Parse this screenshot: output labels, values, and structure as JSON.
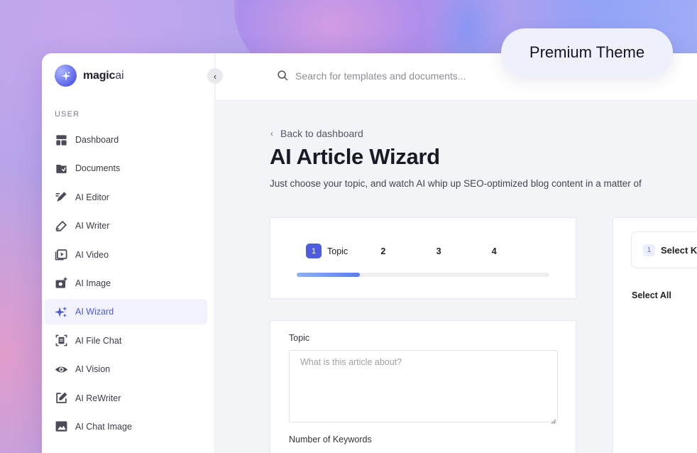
{
  "badge": {
    "label": "Premium Theme"
  },
  "brand": {
    "name_bold": "magic",
    "name_light": "ai"
  },
  "sidebar": {
    "section_label": "USER",
    "items": [
      {
        "label": "Dashboard",
        "icon": "dashboard-icon"
      },
      {
        "label": "Documents",
        "icon": "folder-icon"
      },
      {
        "label": "AI Editor",
        "icon": "editor-icon"
      },
      {
        "label": "AI Writer",
        "icon": "writer-icon"
      },
      {
        "label": "AI Video",
        "icon": "video-icon"
      },
      {
        "label": "AI Image",
        "icon": "camera-icon"
      },
      {
        "label": "AI Wizard",
        "icon": "sparkles-icon",
        "active": true
      },
      {
        "label": "AI File Chat",
        "icon": "file-chat-icon"
      },
      {
        "label": "AI Vision",
        "icon": "eye-icon"
      },
      {
        "label": "AI ReWriter",
        "icon": "pencil-square-icon"
      },
      {
        "label": "AI Chat Image",
        "icon": "image-icon"
      }
    ]
  },
  "search": {
    "placeholder": "Search for templates and documents..."
  },
  "main": {
    "back_label": "Back to dashboard",
    "title": "AI Article Wizard",
    "subtitle": "Just choose your topic, and watch AI whip up SEO-optimized blog content in a matter of"
  },
  "steps": {
    "items": [
      {
        "number": "1",
        "label": "Topic"
      },
      {
        "number": "2"
      },
      {
        "number": "3"
      },
      {
        "number": "4"
      }
    ],
    "progress": 0.25
  },
  "form": {
    "topic_label": "Topic",
    "topic_placeholder": "What is this article about?",
    "keywords_label": "Number of Keywords"
  },
  "keywords_panel": {
    "number": "1",
    "label": "Select K",
    "select_all": "Select All"
  },
  "colors": {
    "accent": "#4e5ce0",
    "active_nav_text": "#4d5ad7",
    "active_nav_bg": "#f1f2fb"
  }
}
